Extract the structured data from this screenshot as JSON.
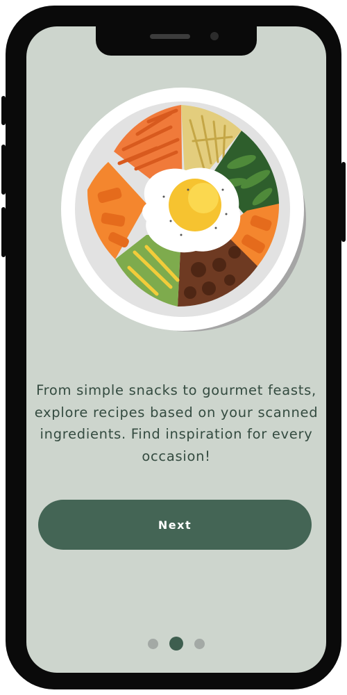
{
  "onboarding": {
    "description": "From simple snacks to gourmet feasts, explore recipes based on your scanned ingredients. Find inspiration for every occasion!",
    "next_label": "Next",
    "illustration": "bibimbap-bowl-illustration"
  },
  "pager": {
    "total": 3,
    "active_index": 1
  },
  "colors": {
    "background": "#cdd5cd",
    "accent": "#446555",
    "text": "#344b40"
  }
}
